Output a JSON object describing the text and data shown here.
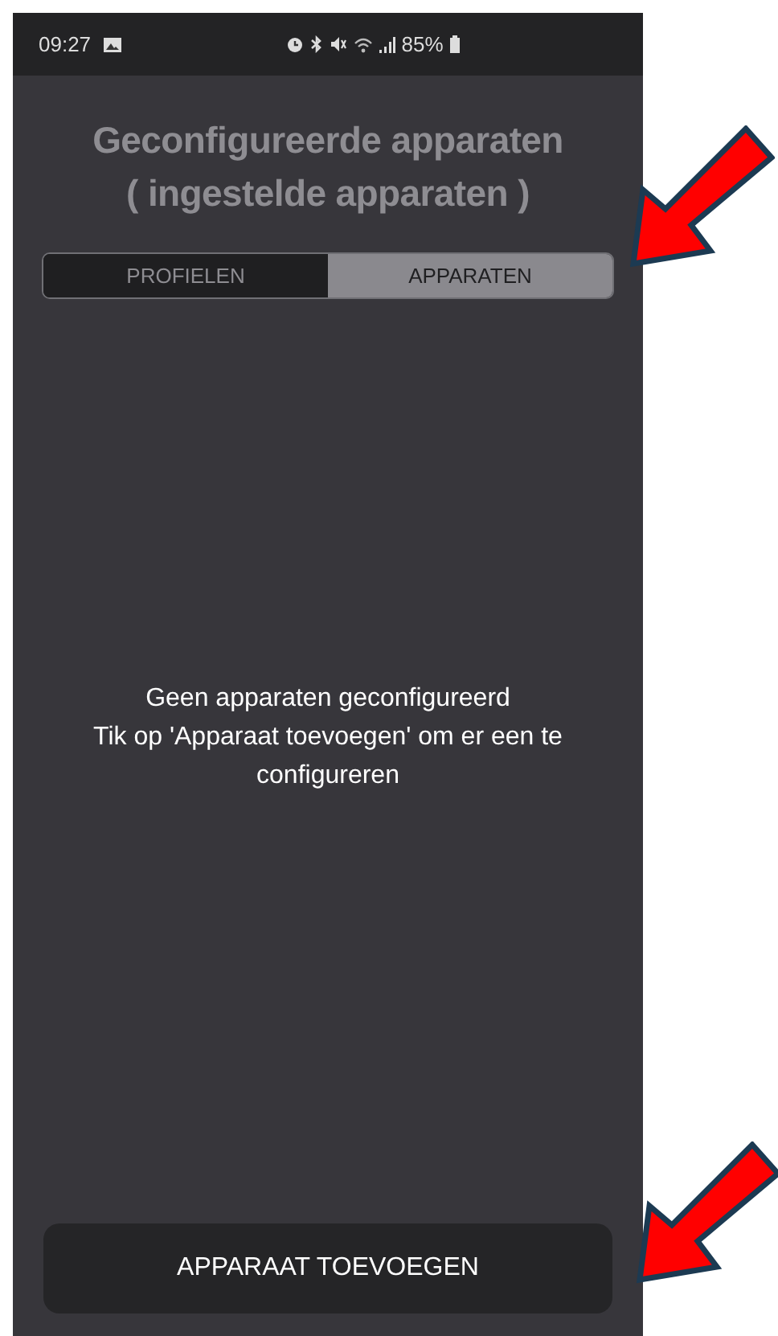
{
  "status_bar": {
    "time": "09:27",
    "battery": "85%"
  },
  "title": {
    "line_1": "Geconfigureerde apparaten",
    "line_2": "( ingestelde apparaten )"
  },
  "tabs": [
    {
      "label": "PROFIELEN",
      "selected": false
    },
    {
      "label": "APPARATEN",
      "selected": true
    }
  ],
  "empty_state": {
    "line_1": "Geen apparaten geconfigureerd",
    "line_2": "Tik op 'Apparaat toevoegen' om er een te configureren"
  },
  "add_button": {
    "label": "APPARAAT TOEVOEGEN"
  }
}
